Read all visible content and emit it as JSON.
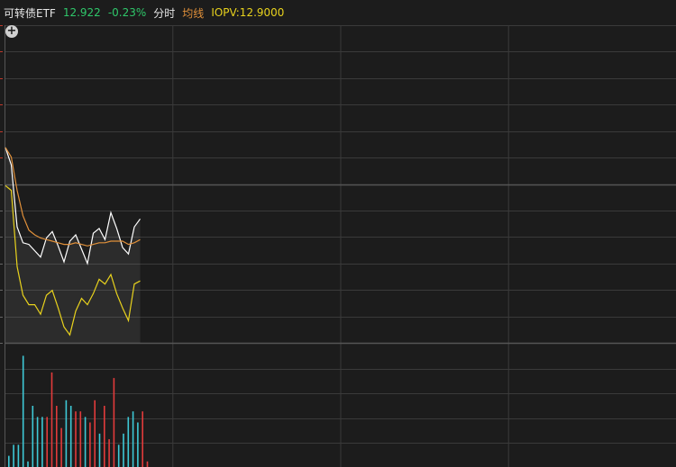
{
  "header": {
    "title": "可转债ETF",
    "price": "12.922",
    "change": "-0.23%",
    "mode": "分时",
    "avg_label": "均线",
    "iopv": "IOPV:12.9000"
  },
  "icons": {
    "zoom": "plus-circle-icon"
  },
  "colors": {
    "bg": "#1c1c1c",
    "grid": "#3a3a3a",
    "price_line": "#ffffff",
    "avg_line": "#e0903a",
    "iopv_line": "#e8d21d",
    "vol_up": "#e23b3b",
    "vol_down": "#3ec9d6",
    "tick_red": "#c0392b"
  },
  "chart_data": {
    "type": "line",
    "series": [
      {
        "key": "price",
        "values": [
          12.9515,
          12.946,
          12.9265,
          12.9215,
          12.921,
          12.919,
          12.917,
          12.923,
          12.925,
          12.9205,
          12.9155,
          12.922,
          12.924,
          12.9195,
          12.915,
          12.9245,
          12.926,
          12.9225,
          12.931,
          12.926,
          12.92,
          12.918,
          12.9265,
          12.929
        ]
      },
      {
        "key": "avg",
        "values": [
          12.9515,
          12.9485,
          12.938,
          12.93,
          12.9255,
          12.924,
          12.923,
          12.9225,
          12.922,
          12.9215,
          12.921,
          12.921,
          12.9215,
          12.921,
          12.9205,
          12.921,
          12.9215,
          12.9215,
          12.922,
          12.922,
          12.922,
          12.921,
          12.9215,
          12.9225
        ]
      },
      {
        "key": "iopv",
        "values": [
          12.9395,
          12.938,
          12.914,
          12.905,
          12.902,
          12.902,
          12.899,
          12.905,
          12.9065,
          12.901,
          12.895,
          12.8925,
          12.9,
          12.904,
          12.902,
          12.9055,
          12.91,
          12.9085,
          12.9115,
          12.9055,
          12.901,
          12.897,
          12.9085,
          12.9095
        ]
      }
    ],
    "volume": [
      {
        "v": 2,
        "dir": "down"
      },
      {
        "v": 4,
        "dir": "down"
      },
      {
        "v": 4,
        "dir": "down"
      },
      {
        "v": 20,
        "dir": "down"
      },
      {
        "v": 1,
        "dir": "down"
      },
      {
        "v": 11,
        "dir": "down"
      },
      {
        "v": 9,
        "dir": "down"
      },
      {
        "v": 9,
        "dir": "down"
      },
      {
        "v": 9,
        "dir": "up"
      },
      {
        "v": 17,
        "dir": "up"
      },
      {
        "v": 11,
        "dir": "up"
      },
      {
        "v": 7,
        "dir": "up"
      },
      {
        "v": 12,
        "dir": "down"
      },
      {
        "v": 11,
        "dir": "down"
      },
      {
        "v": 10,
        "dir": "up"
      },
      {
        "v": 10,
        "dir": "up"
      },
      {
        "v": 9,
        "dir": "down"
      },
      {
        "v": 8,
        "dir": "up"
      },
      {
        "v": 12,
        "dir": "up"
      },
      {
        "v": 6,
        "dir": "down"
      },
      {
        "v": 11,
        "dir": "up"
      },
      {
        "v": 5,
        "dir": "up"
      },
      {
        "v": 16,
        "dir": "up"
      },
      {
        "v": 4,
        "dir": "down"
      },
      {
        "v": 6,
        "dir": "down"
      },
      {
        "v": 9,
        "dir": "down"
      },
      {
        "v": 10,
        "dir": "down"
      },
      {
        "v": 8,
        "dir": "down"
      },
      {
        "v": 10,
        "dir": "up"
      },
      {
        "v": 1,
        "dir": "up"
      }
    ],
    "price_range": [
      12.89,
      12.99
    ],
    "total_minutes": 240,
    "volume_max": 22,
    "grid": true,
    "legend": "header"
  }
}
